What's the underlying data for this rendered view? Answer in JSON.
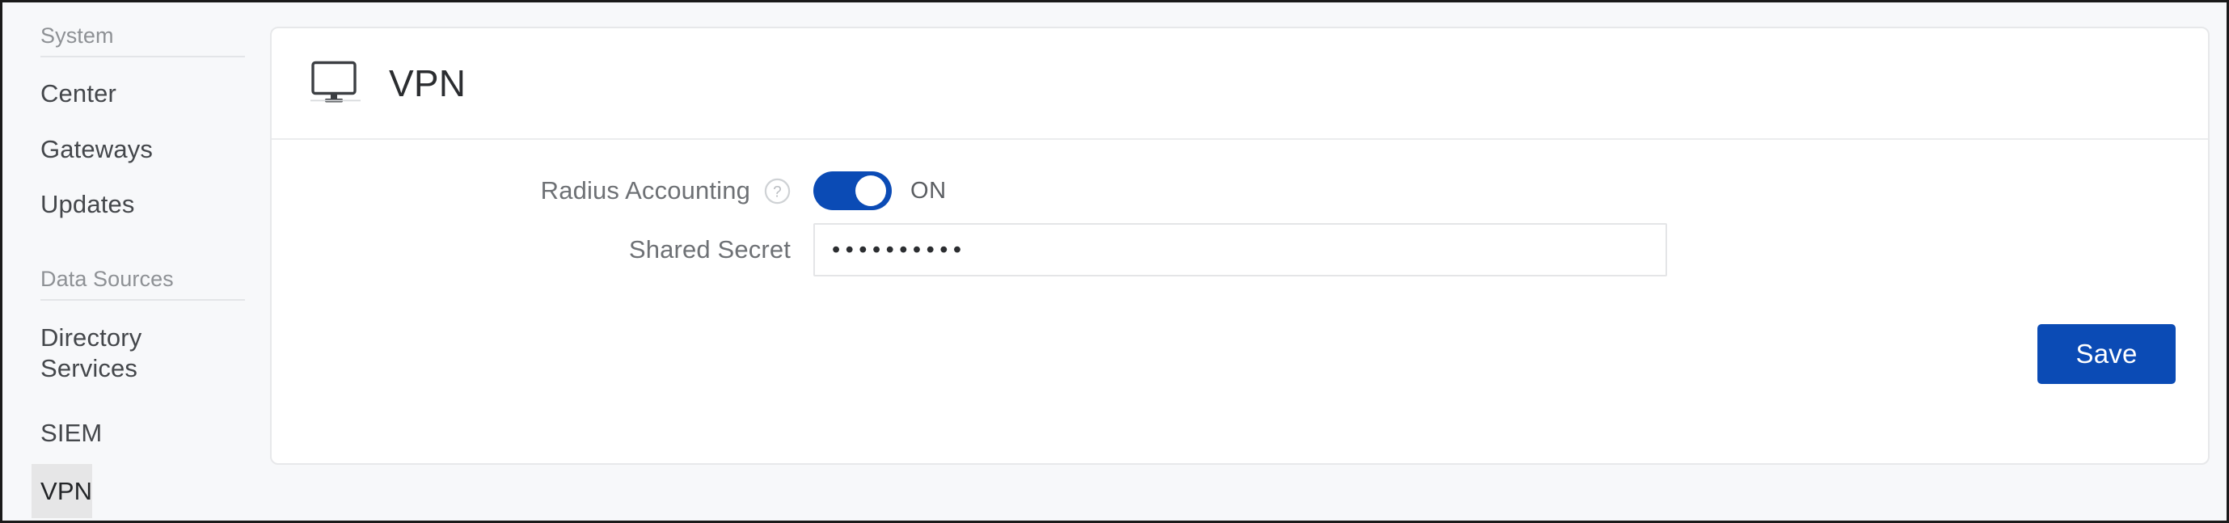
{
  "sidebar": {
    "sections": [
      {
        "header": "System",
        "items": [
          {
            "label": "Center",
            "active": false
          },
          {
            "label": "Gateways",
            "active": false
          },
          {
            "label": "Updates",
            "active": false
          }
        ]
      },
      {
        "header": "Data Sources",
        "items": [
          {
            "label": "Directory Services",
            "active": false
          },
          {
            "label": "SIEM",
            "active": false
          },
          {
            "label": "VPN",
            "active": true
          }
        ]
      }
    ]
  },
  "card": {
    "icon": "monitor-icon",
    "title": "VPN",
    "fields": {
      "radius_accounting": {
        "label": "Radius Accounting",
        "help_icon": "help-circle-icon",
        "toggle_state": "ON",
        "toggle_on": true
      },
      "shared_secret": {
        "label": "Shared Secret",
        "value": "••••••••••",
        "placeholder": ""
      }
    },
    "save_label": "Save"
  },
  "colors": {
    "accent": "#0b4bb5",
    "page_background": "#f7f8fa",
    "card_background": "#ffffff",
    "active_item_background": "#e6e6e7",
    "muted_text": "#8e9195"
  }
}
